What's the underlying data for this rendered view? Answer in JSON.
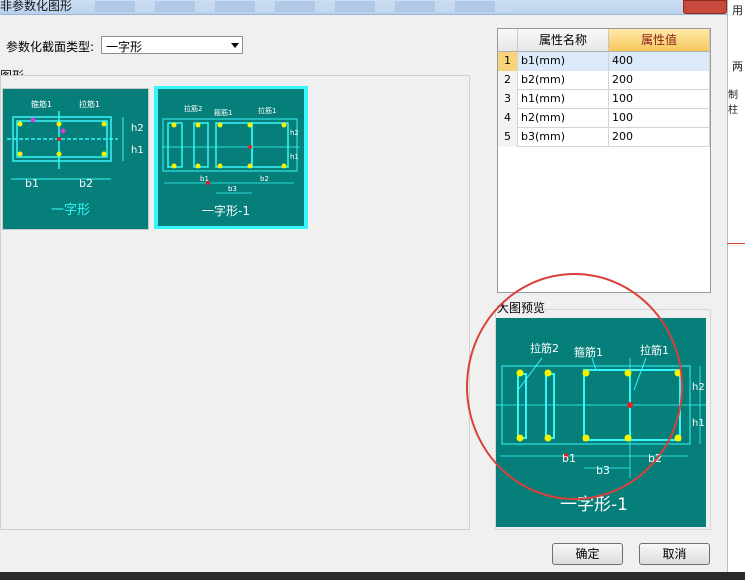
{
  "window": {
    "title": "非参数化图形"
  },
  "section_type": {
    "label": "参数化截面类型:",
    "selected": "一字形"
  },
  "gallery": {
    "label": "图形",
    "items": [
      {
        "name": "一字形",
        "labels": {
          "stirrup": "箍筋1",
          "tie": "拉筋1",
          "b1": "b1",
          "b2": "b2",
          "h1": "h1",
          "h2": "h2"
        }
      },
      {
        "name": "一字形-1",
        "labels": {
          "tie2": "拉筋2",
          "stirrup": "箍筋1",
          "tie1": "拉筋1",
          "b1": "b1",
          "b2": "b2",
          "b3": "b3",
          "h1": "h1",
          "h2": "h2"
        }
      }
    ]
  },
  "table": {
    "headers": [
      "",
      "属性名称",
      "属性值"
    ],
    "rows": [
      {
        "index": "1",
        "name": "b1(mm)",
        "value": "400"
      },
      {
        "index": "2",
        "name": "b2(mm)",
        "value": "200"
      },
      {
        "index": "3",
        "name": "h1(mm)",
        "value": "100"
      },
      {
        "index": "4",
        "name": "h2(mm)",
        "value": "100"
      },
      {
        "index": "5",
        "name": "b3(mm)",
        "value": "200"
      }
    ]
  },
  "preview": {
    "label": "大图预览",
    "caption": "一字形-1",
    "labels": {
      "tie2": "拉筋2",
      "stirrup": "箍筋1",
      "tie1": "拉筋1",
      "b1": "b1",
      "b2": "b2",
      "b3": "b3",
      "h1": "h1",
      "h2": "h2"
    }
  },
  "buttons": {
    "ok": "确定",
    "cancel": "取消"
  },
  "side_text": {
    "line1": "用",
    "line2": "两",
    "line3": "制柱"
  },
  "colors": {
    "teal": "#067f7a",
    "rebar": "#37f6fb",
    "dot": "#f4f400",
    "annotation": "#d9413a"
  }
}
